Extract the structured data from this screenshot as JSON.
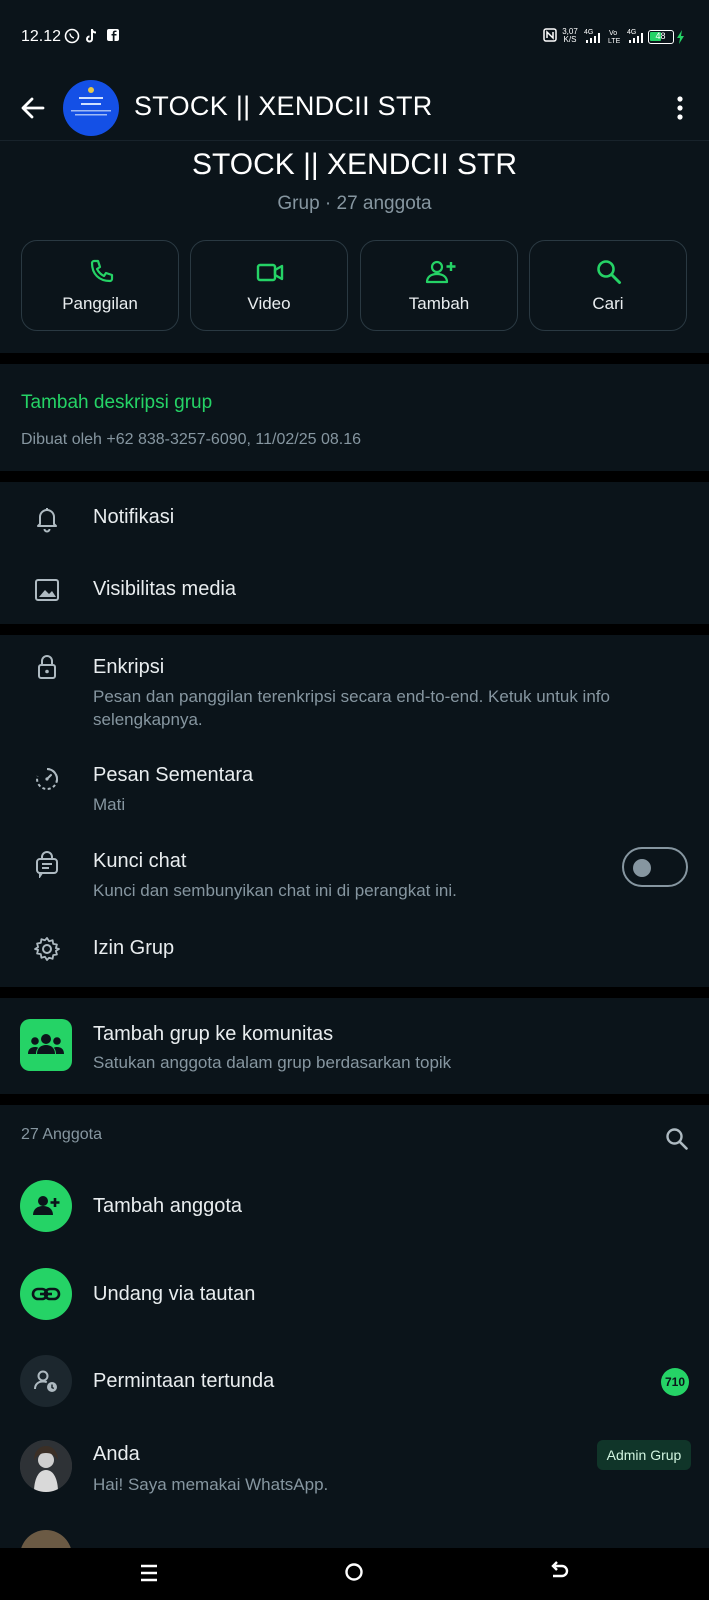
{
  "status_bar": {
    "time": "12.12",
    "net_speed": "3,07 K/S",
    "battery": "48"
  },
  "appbar": {
    "title": "STOCK || XENDCII STR",
    "back_icon": "arrow-left-icon",
    "menu_icon": "more-vert-icon"
  },
  "header": {
    "group_name": "STOCK || XENDCII STR",
    "subtitle": "Grup · 27 anggota"
  },
  "actions": [
    {
      "label": "Panggilan",
      "icon": "phone-icon"
    },
    {
      "label": "Video",
      "icon": "video-icon"
    },
    {
      "label": "Tambah",
      "icon": "add-person-icon"
    },
    {
      "label": "Cari",
      "icon": "search-icon"
    }
  ],
  "description": {
    "add_label": "Tambah deskripsi grup",
    "created_by": "Dibuat oleh +62 838-3257-6090, 11/02/25 08.16"
  },
  "settings": {
    "notifications": "Notifikasi",
    "media_visibility": "Visibilitas media",
    "encryption_title": "Enkripsi",
    "encryption_sub": "Pesan dan panggilan terenkripsi secara end-to-end. Ketuk untuk info selengkapnya.",
    "disappearing_title": "Pesan Sementara",
    "disappearing_sub": "Mati",
    "chat_lock_title": "Kunci chat",
    "chat_lock_sub": "Kunci dan sembunyikan chat ini di perangkat ini.",
    "chat_lock_on": false,
    "group_permissions": "Izin Grup"
  },
  "community": {
    "title": "Tambah grup ke komunitas",
    "subtitle": "Satukan anggota dalam grup berdasarkan topik"
  },
  "members": {
    "count_label": "27 Anggota",
    "add_member": "Tambah anggota",
    "invite_link": "Undang via tautan",
    "pending_requests": "Permintaan tertunda",
    "pending_count": "710",
    "list": [
      {
        "name": "Anda",
        "status": "Hai! Saya memakai WhatsApp.",
        "badge": "Admin Grup"
      }
    ]
  },
  "colors": {
    "accent": "#25d366",
    "background": "#0b141a",
    "separator": "#000000",
    "secondary_text": "#8696a0"
  }
}
